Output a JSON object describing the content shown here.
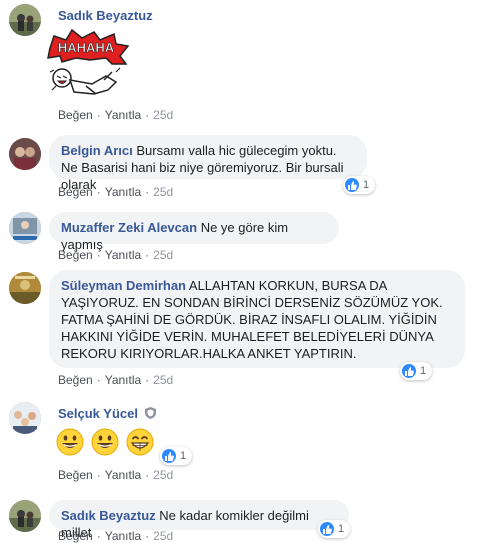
{
  "actions": {
    "like": "Beğen",
    "reply": "Yanıtla",
    "dot": "·"
  },
  "comments": [
    {
      "author": "Sadık Beyaztuz",
      "text": "",
      "sticker_text": "HAHAHA",
      "time": "25d",
      "reactions": ""
    },
    {
      "author": "Belgin Arıcı",
      "text": "Bursamı valla hic gülecegim yoktu. Ne Basarisi hani biz niye göremiyoruz. Bir bursali olarak",
      "time": "25d",
      "reactions": "1"
    },
    {
      "author": "Muzaffer Zeki Alevcan",
      "text": "Ne ye göre kim yapmış",
      "time": "25d",
      "reactions": ""
    },
    {
      "author": "Süleyman Demirhan",
      "text": "ALLAHTAN KORKUN, BURSA DA YAŞIYORUZ. EN SONDAN BİRİNCİ DERSENİZ SÖZÜMÜZ YOK. FATMA ŞAHİNİ DE GÖRDÜK. BİRAZ İNSAFLI OLALIM. YİĞİDİN HAKKINI YİĞİDE VERİN. MUHALEFET BELEDİYELERİ DÜNYA REKORU KIRIYORLAR.HALKA ANKET YAPTIRIN.",
      "time": "25d",
      "reactions": "1"
    },
    {
      "author": "Selçuk Yücel",
      "text": "",
      "time": "25d",
      "reactions": "1",
      "emojis": [
        "grinning-face",
        "grinning-face",
        "beaming-face"
      ]
    },
    {
      "author": "Sadık Beyaztuz",
      "text": "Ne kadar komikler değilmi millet",
      "time": "25d",
      "reactions": "1"
    }
  ],
  "colors": {
    "name": "#385898",
    "bubble": "#f2f3f5",
    "like_blue": "#2e89ff",
    "meta": "#606770"
  }
}
